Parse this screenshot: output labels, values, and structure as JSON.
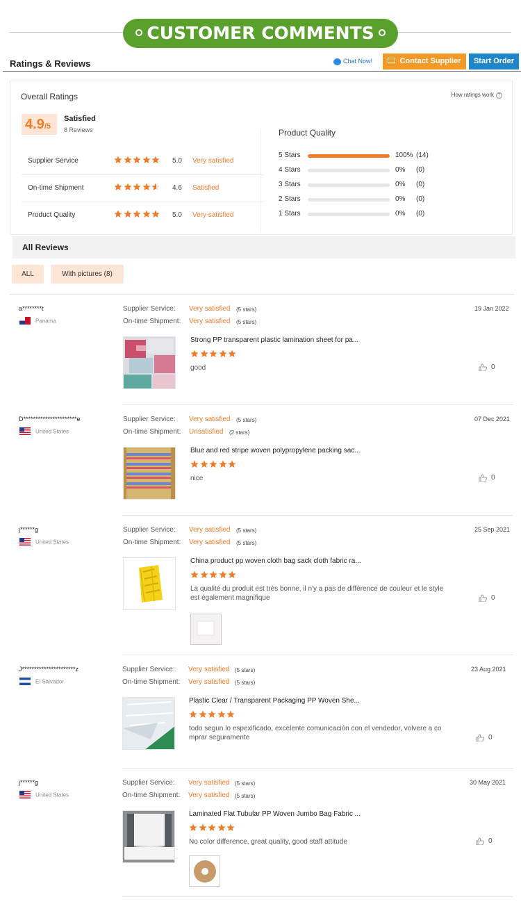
{
  "banner": {
    "title": "CUSTOMER COMMENTS"
  },
  "header": {
    "title": "Ratings & Reviews",
    "chat_label": "Chat Now!",
    "contact_label": "Contact Supplier",
    "start_label": "Start Order"
  },
  "overall": {
    "title": "Overall Ratings",
    "how_link": "How ratings work",
    "score": "4.9",
    "score_max": "/5",
    "sentiment": "Satisfied",
    "review_count": "8 Reviews",
    "rows": [
      {
        "label": "Supplier Service",
        "rating": 5.0,
        "value": "5.0",
        "word": "Very satisfied"
      },
      {
        "label": "On-time Shipment",
        "rating": 4.6,
        "value": "4.6",
        "word": "Satisfied"
      },
      {
        "label": "Product Quality",
        "rating": 5.0,
        "value": "5.0",
        "word": "Very satisfied"
      }
    ],
    "product_quality": {
      "title": "Product Quality",
      "bars": [
        {
          "label": "5  Stars",
          "fraction": 1.0,
          "pct": "100%",
          "count": "(14)"
        },
        {
          "label": "4  Stars",
          "fraction": 0,
          "pct": "0%",
          "count": "(0)"
        },
        {
          "label": "3  Stars",
          "fraction": 0,
          "pct": "0%",
          "count": "(0)"
        },
        {
          "label": "2  Stars",
          "fraction": 0,
          "pct": "0%",
          "count": "(0)"
        },
        {
          "label": "1  Stars",
          "fraction": 0,
          "pct": "0%",
          "count": "(0)"
        }
      ]
    }
  },
  "all_reviews": {
    "title": "All Reviews",
    "filter_all": "ALL",
    "filter_pictures": "With pictures (8)"
  },
  "labels": {
    "supplier_service": "Supplier Service:",
    "ontime_shipment": "On-time Shipment:"
  },
  "reviews": [
    {
      "reviewer": "a********t",
      "country": "Panama",
      "flag": "pa",
      "service": "Very satisfied",
      "service_stars": "(5 stars)",
      "shipment": "Very satisfied",
      "shipment_stars": "(5 stars)",
      "date": "19 Jan 2022",
      "product": "Strong PP transparent plastic lamination sheet for pa...",
      "rating": 5,
      "comment": "good",
      "likes": "0",
      "attachment": false
    },
    {
      "reviewer": "D**********************e",
      "country": "United States",
      "flag": "us",
      "service": "Very satisfied",
      "service_stars": "(5 stars)",
      "shipment": "Unsatisfied",
      "shipment_stars": "(2 stars)",
      "date": "07 Dec 2021",
      "product": "Blue and red stripe woven polypropylene packing sac...",
      "rating": 5,
      "comment": "nice",
      "likes": "0",
      "attachment": false
    },
    {
      "reviewer": "j******g",
      "country": "United States",
      "flag": "us",
      "service": "Very satisfied",
      "service_stars": "(5 stars)",
      "shipment": "Very satisfied",
      "shipment_stars": "(5 stars)",
      "date": "25 Sep 2021",
      "product": "China product pp woven cloth bag sack cloth fabric ra...",
      "rating": 5,
      "comment": "La qualité du produit est très bonne, il n'y a pas de différence de couleur et le style est également magnifique",
      "likes": "0",
      "attachment": true
    },
    {
      "reviewer": "J**********************z",
      "country": "El Salvador",
      "flag": "sv",
      "service": "Very satisfied",
      "service_stars": "(5 stars)",
      "shipment": "Very satisfied",
      "shipment_stars": "(5 stars)",
      "date": "23 Aug 2021",
      "product": "Plastic Clear / Transparent Packaging PP Woven She...",
      "rating": 5,
      "comment": "todo segun lo espexificado, excelente comunicación con el vendedor, volvere a co mprar seguramente",
      "likes": "0",
      "attachment": false
    },
    {
      "reviewer": "j******g",
      "country": "United States",
      "flag": "us",
      "service": "Very satisfied",
      "service_stars": "(5 stars)",
      "shipment": "Very satisfied",
      "shipment_stars": "(5 stars)",
      "date": "30 May 2021",
      "product": "Laminated Flat Tubular PP Woven Jumbo Bag Fabric ...",
      "rating": 5,
      "comment": "No color difference, great quality, good staff attitude",
      "likes": "0",
      "attachment": true
    }
  ],
  "colors": {
    "accent": "#f07b28",
    "banner_green": "#5aa02c",
    "contact": "#f39a26",
    "start": "#1f86c9"
  }
}
